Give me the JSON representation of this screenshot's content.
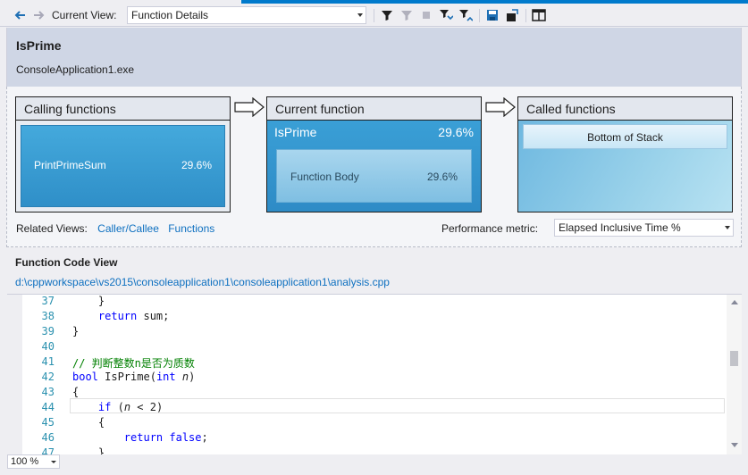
{
  "toolbar": {
    "current_view_label": "Current View:",
    "current_view_value": "Function Details"
  },
  "header": {
    "function_name": "IsPrime",
    "module": "ConsoleApplication1.exe"
  },
  "calling": {
    "title": "Calling functions",
    "item_name": "PrintPrimeSum",
    "item_pct": "29.6%"
  },
  "current": {
    "title": "Current function",
    "name": "IsPrime",
    "pct": "29.6%",
    "body_name": "Function Body",
    "body_pct": "29.6%"
  },
  "called": {
    "title": "Called functions",
    "bottom_button": "Bottom of Stack"
  },
  "related": {
    "label": "Related Views:",
    "link1": "Caller/Callee",
    "link2": "Functions"
  },
  "performance": {
    "label": "Performance metric:",
    "value": "Elapsed Inclusive Time %"
  },
  "code_view": {
    "title": "Function Code View",
    "path": "d:\\cppworkspace\\vs2015\\consoleapplication1\\consoleapplication1\\analysis.cpp",
    "lines": [
      {
        "num": "37",
        "text": "    }"
      },
      {
        "num": "38",
        "text": "    return sum;"
      },
      {
        "num": "39",
        "text": "}"
      },
      {
        "num": "40",
        "text": ""
      },
      {
        "num": "41",
        "text": "// 判断整数n是否为质数"
      },
      {
        "num": "42",
        "text": "bool IsPrime(int n)"
      },
      {
        "num": "43",
        "text": "{"
      },
      {
        "num": "44",
        "text": "    if (n < 2)"
      },
      {
        "num": "45",
        "text": "    {"
      },
      {
        "num": "46",
        "text": "        return false;"
      },
      {
        "num": "47",
        "text": "    }"
      }
    ]
  },
  "status": {
    "zoom": "100 %"
  },
  "icons": [
    "back-arrow-icon",
    "forward-arrow-icon",
    "filter-icon",
    "clear-filter-icon",
    "stop-icon",
    "collapse-icon",
    "expand-icon",
    "save-icon",
    "export-icon",
    "split-view-icon"
  ]
}
